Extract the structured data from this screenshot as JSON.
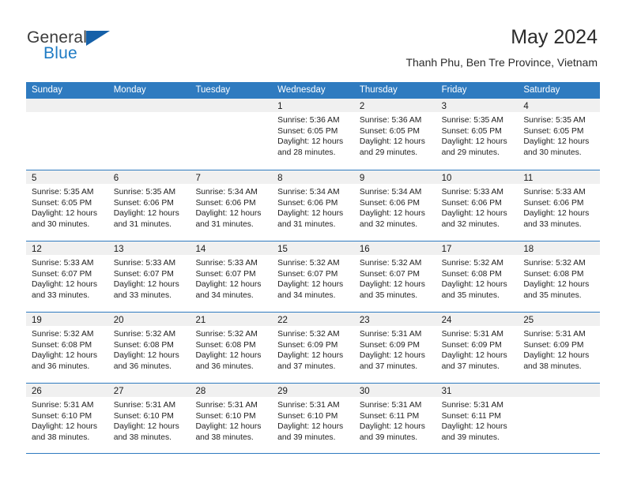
{
  "brand": {
    "word1": "General",
    "word2": "Blue",
    "flag_icon": "triangle-flag-icon",
    "accent_color": "#1560a8"
  },
  "header": {
    "title": "May 2024",
    "subtitle": "Thanh Phu, Ben Tre Province, Vietnam"
  },
  "theme": {
    "header_blue": "#2f7bc0",
    "day_head_gray": "#f0f0f0",
    "text_color": "#222222"
  },
  "weekdays": [
    "Sunday",
    "Monday",
    "Tuesday",
    "Wednesday",
    "Thursday",
    "Friday",
    "Saturday"
  ],
  "weeks": [
    [
      {
        "day": "",
        "empty": true,
        "sunrise": "",
        "sunset": "",
        "daylight1": "",
        "daylight2": ""
      },
      {
        "day": "",
        "empty": true,
        "sunrise": "",
        "sunset": "",
        "daylight1": "",
        "daylight2": ""
      },
      {
        "day": "",
        "empty": true,
        "sunrise": "",
        "sunset": "",
        "daylight1": "",
        "daylight2": ""
      },
      {
        "day": "1",
        "empty": false,
        "sunrise": "Sunrise: 5:36 AM",
        "sunset": "Sunset: 6:05 PM",
        "daylight1": "Daylight: 12 hours",
        "daylight2": "and 28 minutes."
      },
      {
        "day": "2",
        "empty": false,
        "sunrise": "Sunrise: 5:36 AM",
        "sunset": "Sunset: 6:05 PM",
        "daylight1": "Daylight: 12 hours",
        "daylight2": "and 29 minutes."
      },
      {
        "day": "3",
        "empty": false,
        "sunrise": "Sunrise: 5:35 AM",
        "sunset": "Sunset: 6:05 PM",
        "daylight1": "Daylight: 12 hours",
        "daylight2": "and 29 minutes."
      },
      {
        "day": "4",
        "empty": false,
        "sunrise": "Sunrise: 5:35 AM",
        "sunset": "Sunset: 6:05 PM",
        "daylight1": "Daylight: 12 hours",
        "daylight2": "and 30 minutes."
      }
    ],
    [
      {
        "day": "5",
        "empty": false,
        "sunrise": "Sunrise: 5:35 AM",
        "sunset": "Sunset: 6:05 PM",
        "daylight1": "Daylight: 12 hours",
        "daylight2": "and 30 minutes."
      },
      {
        "day": "6",
        "empty": false,
        "sunrise": "Sunrise: 5:35 AM",
        "sunset": "Sunset: 6:06 PM",
        "daylight1": "Daylight: 12 hours",
        "daylight2": "and 31 minutes."
      },
      {
        "day": "7",
        "empty": false,
        "sunrise": "Sunrise: 5:34 AM",
        "sunset": "Sunset: 6:06 PM",
        "daylight1": "Daylight: 12 hours",
        "daylight2": "and 31 minutes."
      },
      {
        "day": "8",
        "empty": false,
        "sunrise": "Sunrise: 5:34 AM",
        "sunset": "Sunset: 6:06 PM",
        "daylight1": "Daylight: 12 hours",
        "daylight2": "and 31 minutes."
      },
      {
        "day": "9",
        "empty": false,
        "sunrise": "Sunrise: 5:34 AM",
        "sunset": "Sunset: 6:06 PM",
        "daylight1": "Daylight: 12 hours",
        "daylight2": "and 32 minutes."
      },
      {
        "day": "10",
        "empty": false,
        "sunrise": "Sunrise: 5:33 AM",
        "sunset": "Sunset: 6:06 PM",
        "daylight1": "Daylight: 12 hours",
        "daylight2": "and 32 minutes."
      },
      {
        "day": "11",
        "empty": false,
        "sunrise": "Sunrise: 5:33 AM",
        "sunset": "Sunset: 6:06 PM",
        "daylight1": "Daylight: 12 hours",
        "daylight2": "and 33 minutes."
      }
    ],
    [
      {
        "day": "12",
        "empty": false,
        "sunrise": "Sunrise: 5:33 AM",
        "sunset": "Sunset: 6:07 PM",
        "daylight1": "Daylight: 12 hours",
        "daylight2": "and 33 minutes."
      },
      {
        "day": "13",
        "empty": false,
        "sunrise": "Sunrise: 5:33 AM",
        "sunset": "Sunset: 6:07 PM",
        "daylight1": "Daylight: 12 hours",
        "daylight2": "and 33 minutes."
      },
      {
        "day": "14",
        "empty": false,
        "sunrise": "Sunrise: 5:33 AM",
        "sunset": "Sunset: 6:07 PM",
        "daylight1": "Daylight: 12 hours",
        "daylight2": "and 34 minutes."
      },
      {
        "day": "15",
        "empty": false,
        "sunrise": "Sunrise: 5:32 AM",
        "sunset": "Sunset: 6:07 PM",
        "daylight1": "Daylight: 12 hours",
        "daylight2": "and 34 minutes."
      },
      {
        "day": "16",
        "empty": false,
        "sunrise": "Sunrise: 5:32 AM",
        "sunset": "Sunset: 6:07 PM",
        "daylight1": "Daylight: 12 hours",
        "daylight2": "and 35 minutes."
      },
      {
        "day": "17",
        "empty": false,
        "sunrise": "Sunrise: 5:32 AM",
        "sunset": "Sunset: 6:08 PM",
        "daylight1": "Daylight: 12 hours",
        "daylight2": "and 35 minutes."
      },
      {
        "day": "18",
        "empty": false,
        "sunrise": "Sunrise: 5:32 AM",
        "sunset": "Sunset: 6:08 PM",
        "daylight1": "Daylight: 12 hours",
        "daylight2": "and 35 minutes."
      }
    ],
    [
      {
        "day": "19",
        "empty": false,
        "sunrise": "Sunrise: 5:32 AM",
        "sunset": "Sunset: 6:08 PM",
        "daylight1": "Daylight: 12 hours",
        "daylight2": "and 36 minutes."
      },
      {
        "day": "20",
        "empty": false,
        "sunrise": "Sunrise: 5:32 AM",
        "sunset": "Sunset: 6:08 PM",
        "daylight1": "Daylight: 12 hours",
        "daylight2": "and 36 minutes."
      },
      {
        "day": "21",
        "empty": false,
        "sunrise": "Sunrise: 5:32 AM",
        "sunset": "Sunset: 6:08 PM",
        "daylight1": "Daylight: 12 hours",
        "daylight2": "and 36 minutes."
      },
      {
        "day": "22",
        "empty": false,
        "sunrise": "Sunrise: 5:32 AM",
        "sunset": "Sunset: 6:09 PM",
        "daylight1": "Daylight: 12 hours",
        "daylight2": "and 37 minutes."
      },
      {
        "day": "23",
        "empty": false,
        "sunrise": "Sunrise: 5:31 AM",
        "sunset": "Sunset: 6:09 PM",
        "daylight1": "Daylight: 12 hours",
        "daylight2": "and 37 minutes."
      },
      {
        "day": "24",
        "empty": false,
        "sunrise": "Sunrise: 5:31 AM",
        "sunset": "Sunset: 6:09 PM",
        "daylight1": "Daylight: 12 hours",
        "daylight2": "and 37 minutes."
      },
      {
        "day": "25",
        "empty": false,
        "sunrise": "Sunrise: 5:31 AM",
        "sunset": "Sunset: 6:09 PM",
        "daylight1": "Daylight: 12 hours",
        "daylight2": "and 38 minutes."
      }
    ],
    [
      {
        "day": "26",
        "empty": false,
        "sunrise": "Sunrise: 5:31 AM",
        "sunset": "Sunset: 6:10 PM",
        "daylight1": "Daylight: 12 hours",
        "daylight2": "and 38 minutes."
      },
      {
        "day": "27",
        "empty": false,
        "sunrise": "Sunrise: 5:31 AM",
        "sunset": "Sunset: 6:10 PM",
        "daylight1": "Daylight: 12 hours",
        "daylight2": "and 38 minutes."
      },
      {
        "day": "28",
        "empty": false,
        "sunrise": "Sunrise: 5:31 AM",
        "sunset": "Sunset: 6:10 PM",
        "daylight1": "Daylight: 12 hours",
        "daylight2": "and 38 minutes."
      },
      {
        "day": "29",
        "empty": false,
        "sunrise": "Sunrise: 5:31 AM",
        "sunset": "Sunset: 6:10 PM",
        "daylight1": "Daylight: 12 hours",
        "daylight2": "and 39 minutes."
      },
      {
        "day": "30",
        "empty": false,
        "sunrise": "Sunrise: 5:31 AM",
        "sunset": "Sunset: 6:11 PM",
        "daylight1": "Daylight: 12 hours",
        "daylight2": "and 39 minutes."
      },
      {
        "day": "31",
        "empty": false,
        "sunrise": "Sunrise: 5:31 AM",
        "sunset": "Sunset: 6:11 PM",
        "daylight1": "Daylight: 12 hours",
        "daylight2": "and 39 minutes."
      },
      {
        "day": "",
        "empty": true,
        "sunrise": "",
        "sunset": "",
        "daylight1": "",
        "daylight2": ""
      }
    ]
  ]
}
